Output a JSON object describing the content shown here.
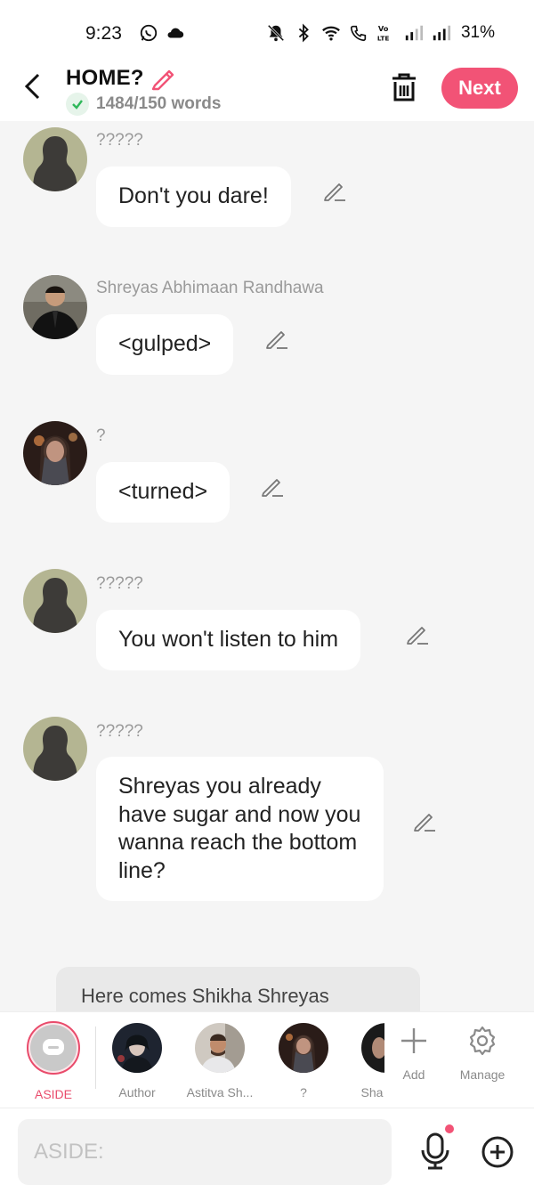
{
  "status_bar": {
    "time": "9:23",
    "battery": "31%",
    "left_icons": [
      "whatsapp-icon",
      "cloud-icon"
    ],
    "right_icons": [
      "mute-icon",
      "bluetooth-icon",
      "wifi-icon",
      "wifi-call-icon",
      "volte-icon",
      "signal-icon",
      "signal-icon"
    ]
  },
  "header": {
    "title": "HOME?",
    "word_count": "1484/150 words",
    "next_label": "Next",
    "accent_color": "#f25376"
  },
  "messages": [
    {
      "sender": "?????",
      "text": "Don't you dare!",
      "avatar": "silhouette"
    },
    {
      "sender": "Shreyas Abhimaan Randhawa",
      "text": "<gulped>",
      "avatar": "man-suit"
    },
    {
      "sender": "?",
      "text": "<turned>",
      "avatar": "woman-veil"
    },
    {
      "sender": "?????",
      "text": "You won't listen to him",
      "avatar": "silhouette"
    },
    {
      "sender": "?????",
      "text": "Shreyas you already have sugar and now you wanna reach the bottom line?",
      "avatar": "silhouette"
    }
  ],
  "aside_message": "Here comes Shikha Shreyas",
  "characters": [
    {
      "label": "ASIDE",
      "active": true
    },
    {
      "label": "Author",
      "active": false
    },
    {
      "label": "Astitva Sh...",
      "active": false
    },
    {
      "label": "?",
      "active": false
    },
    {
      "label": "Sha",
      "active": false
    }
  ],
  "tools": {
    "add_label": "Add",
    "manage_label": "Manage"
  },
  "input": {
    "placeholder": "ASIDE:"
  }
}
